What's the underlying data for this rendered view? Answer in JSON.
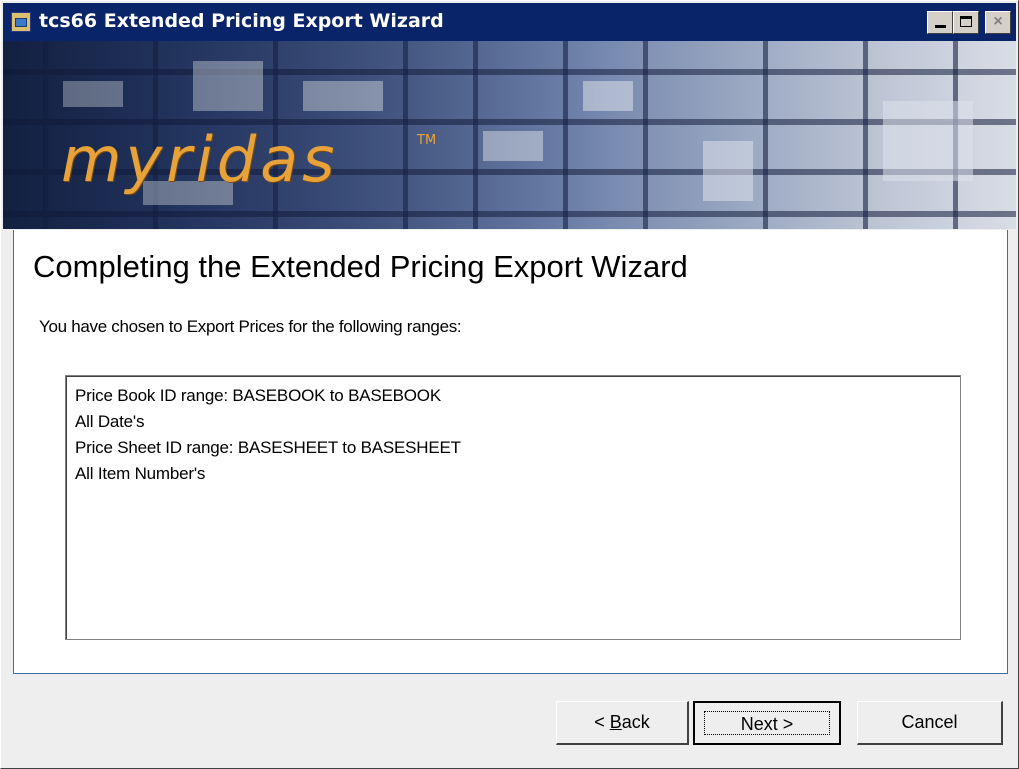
{
  "window": {
    "title": "tcs66 Extended Pricing Export Wizard",
    "controls": {
      "minimize": "minimize",
      "maximize": "maximize",
      "close": "×"
    }
  },
  "banner": {
    "logo_text": "myridas",
    "trademark": "TM"
  },
  "page": {
    "heading": "Completing the Extended Pricing Export Wizard",
    "intro": "You have chosen to Export Prices for the following ranges:",
    "summary_lines": [
      "Price Book ID range: BASEBOOK to BASEBOOK",
      "All Date's",
      "Price Sheet ID range: BASESHEET to BASESHEET",
      "All Item Number's"
    ]
  },
  "buttons": {
    "back_prefix": "< ",
    "back_mnemonic": "B",
    "back_rest": "ack",
    "next": "Next >",
    "cancel": "Cancel"
  },
  "colors": {
    "titlebar": "#0a246a",
    "content_border": "#3f6fa8",
    "logo": "#e8a23a"
  }
}
